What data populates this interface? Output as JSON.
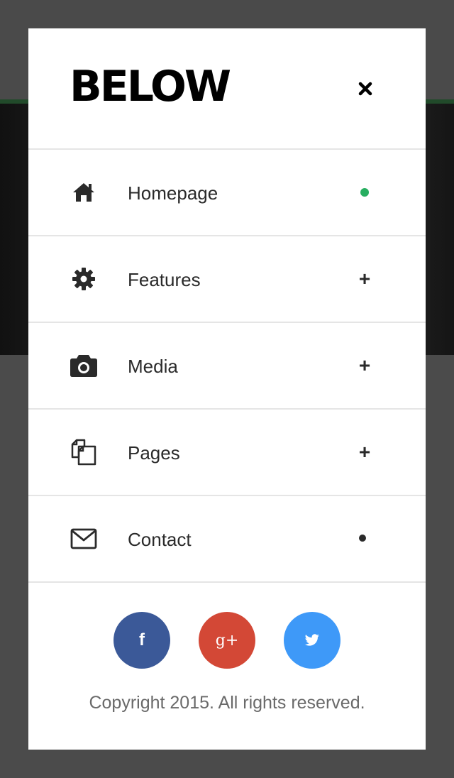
{
  "app": {
    "logo_text": "BELOW",
    "close_icon": "close-icon"
  },
  "menu": {
    "items": [
      {
        "label": "Homepage",
        "icon": "home-icon",
        "indicator": "active-dot",
        "indicator_color": "#27ae60"
      },
      {
        "label": "Features",
        "icon": "gear-icon",
        "indicator": "+"
      },
      {
        "label": "Media",
        "icon": "camera-icon",
        "indicator": "+"
      },
      {
        "label": "Pages",
        "icon": "pages-icon",
        "indicator": "+"
      },
      {
        "label": "Contact",
        "icon": "envelope-icon",
        "indicator": "dot",
        "indicator_color": "#2a2a2a"
      }
    ]
  },
  "social": [
    {
      "name": "facebook",
      "glyph": "f",
      "color": "#3b5998"
    },
    {
      "name": "google-plus",
      "glyph": "g+",
      "color": "#d34836"
    },
    {
      "name": "twitter",
      "glyph": "twitter-bird",
      "color": "#3e99f8"
    }
  ],
  "footer": {
    "copyright": "Copyright 2015. All rights reserved."
  },
  "colors": {
    "accent": "#27ae60",
    "overlay": "#4a4a4a",
    "panel": "#ffffff"
  }
}
